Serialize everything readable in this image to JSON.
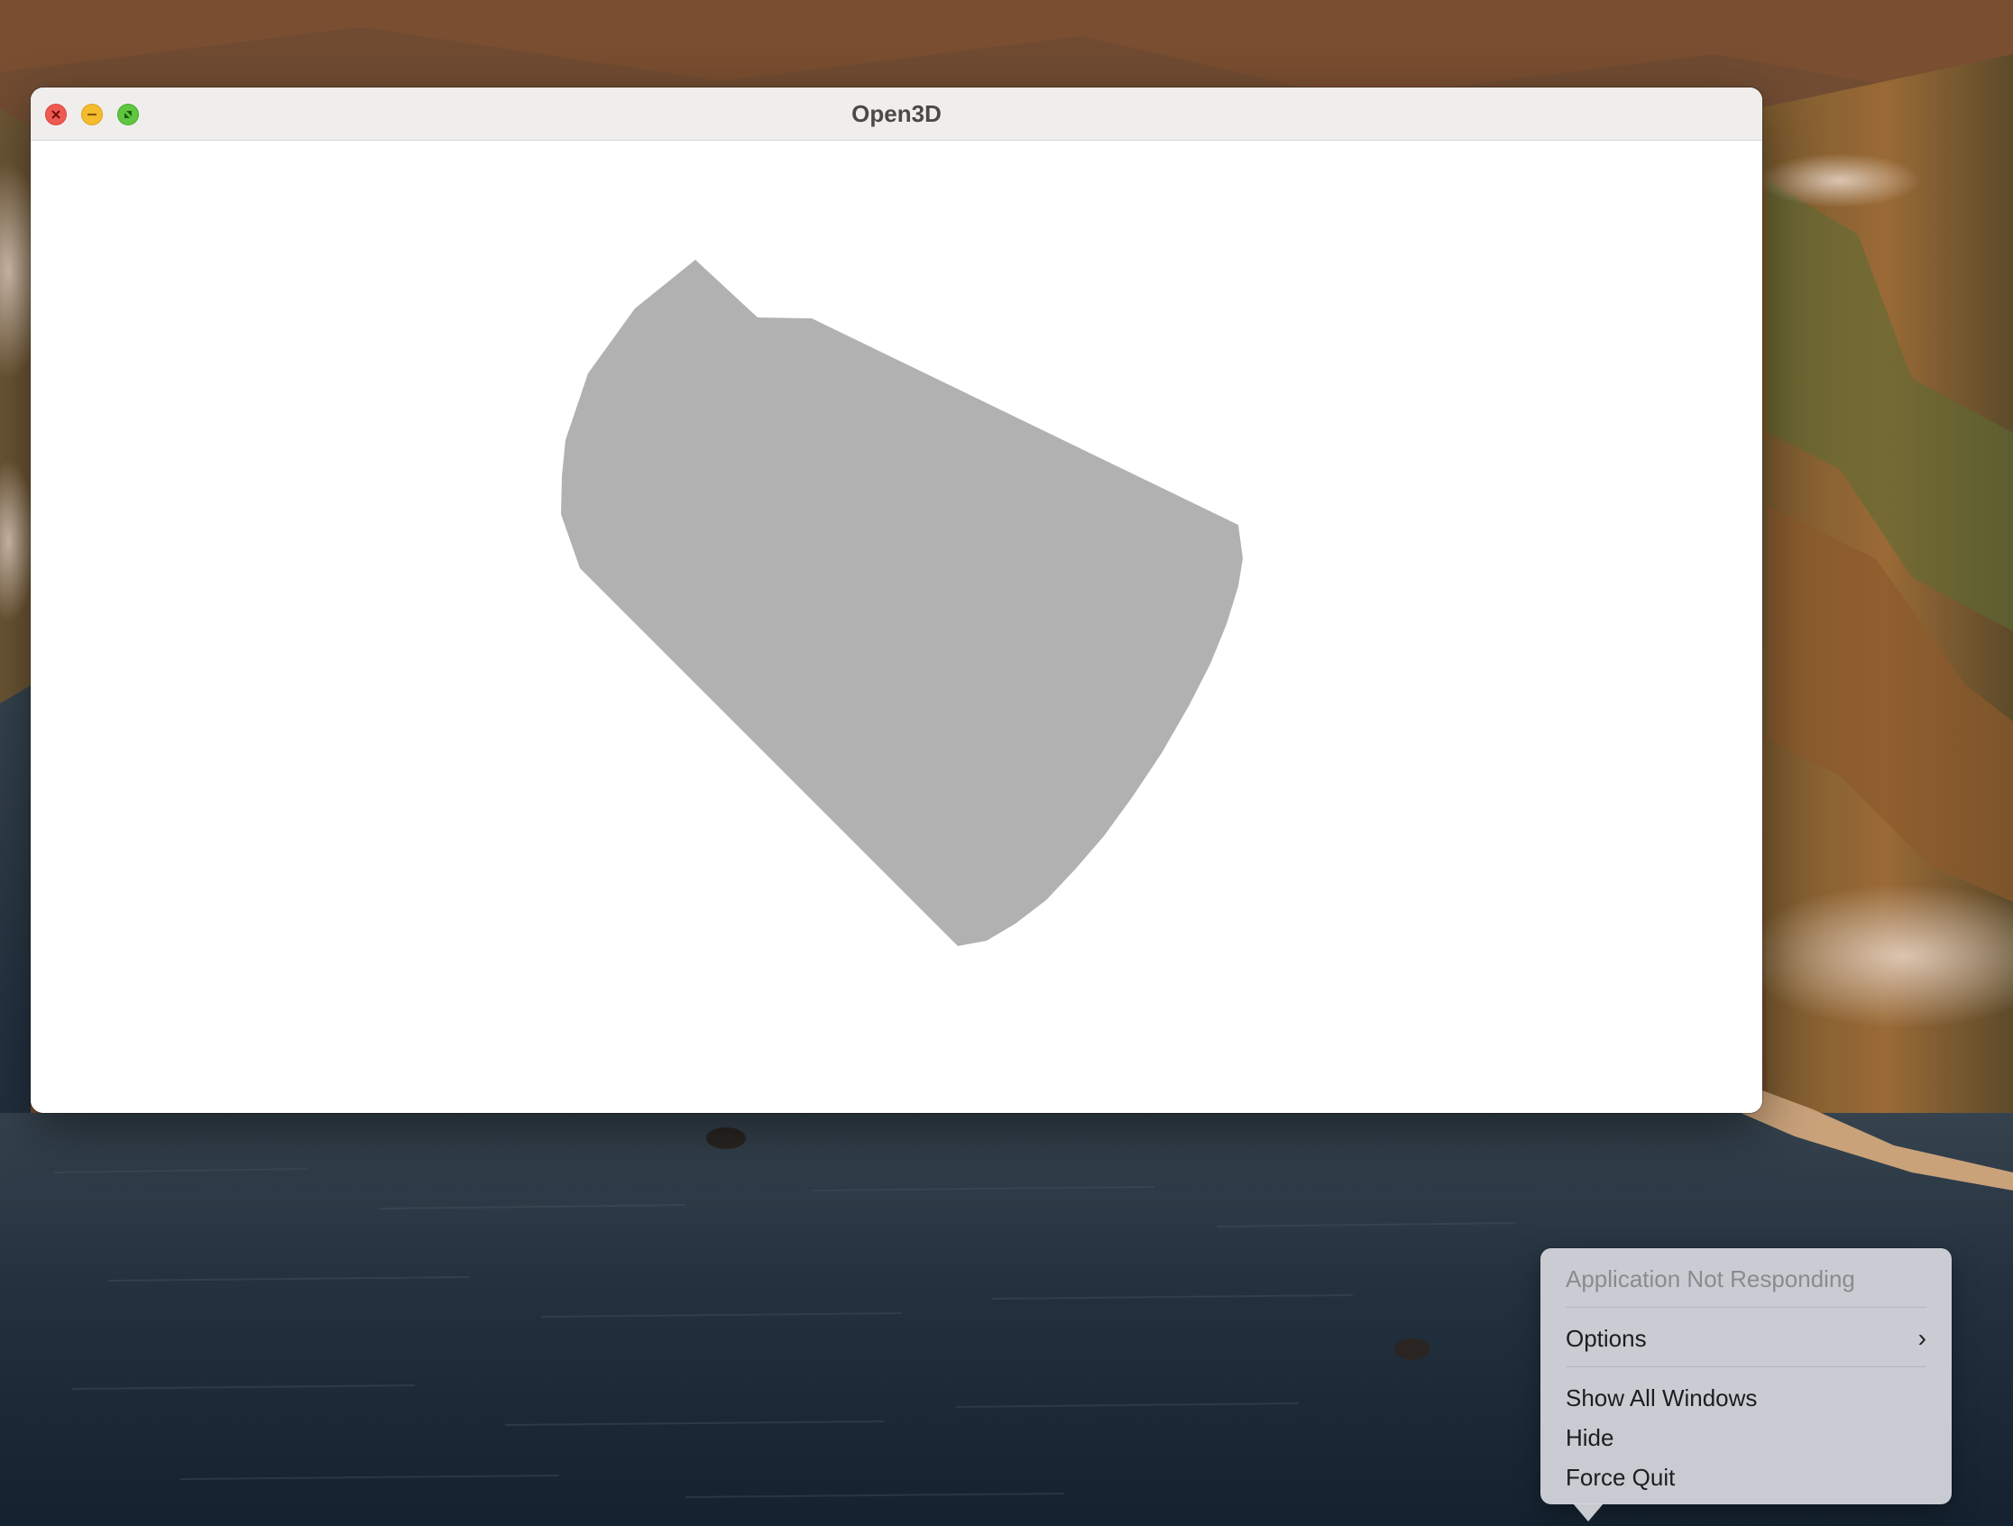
{
  "window": {
    "title": "Open3D",
    "buttons": {
      "close_icon": "close-icon",
      "minimize_icon": "minimize-icon",
      "maximize_icon": "fullscreen-icon"
    }
  },
  "viewport": {
    "background_color": "#ffffff",
    "mesh_color": "#b1b1b1"
  },
  "dock_menu": {
    "status": "Application Not Responding",
    "items": [
      {
        "label": "Options",
        "submenu_icon": "chevron-right-icon"
      },
      {
        "label": "Show All Windows"
      },
      {
        "label": "Hide"
      },
      {
        "label": "Force Quit"
      }
    ]
  },
  "colors": {
    "close": "#ee5a52",
    "minimize": "#f5bd2e",
    "maximize": "#5ec73f"
  }
}
